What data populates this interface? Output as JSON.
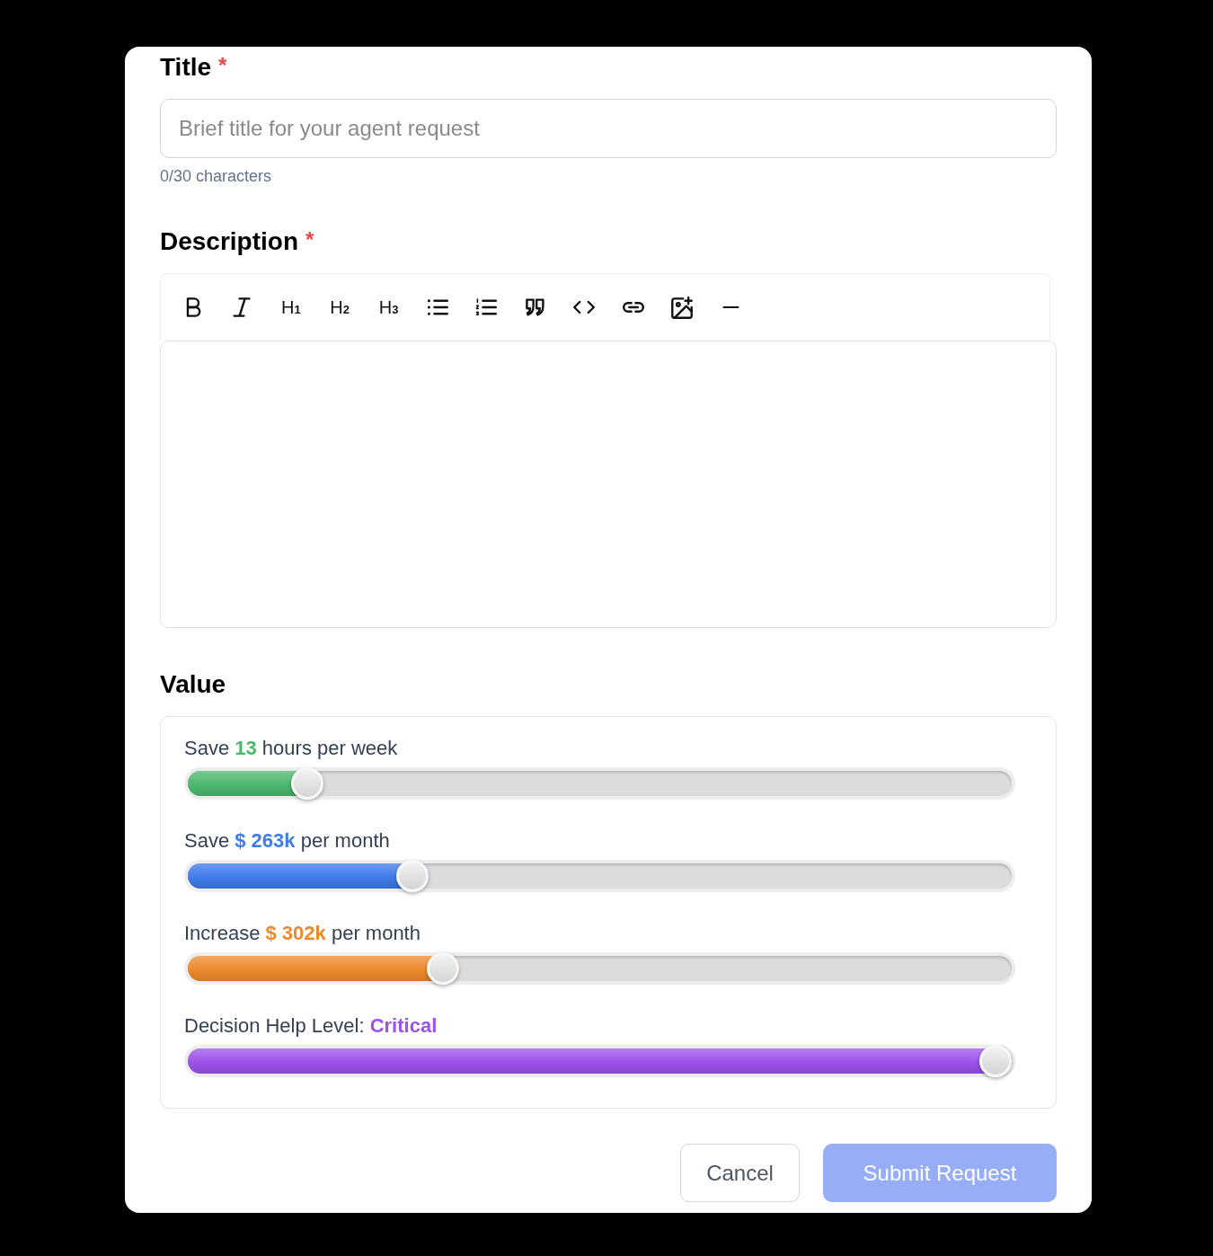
{
  "title_field": {
    "label": "Title",
    "required_mark": "*",
    "placeholder": "Brief title for your agent request",
    "counter": "0/30 characters"
  },
  "description_field": {
    "label": "Description",
    "required_mark": "*",
    "toolbar": [
      {
        "kind": "bold"
      },
      {
        "kind": "italic"
      },
      {
        "kind": "heading",
        "label": "H$_{1}$"
      },
      {
        "kind": "heading",
        "label": "H$_{2}$"
      },
      {
        "kind": "heading",
        "label": "H$_{3}$"
      },
      {
        "kind": "bullet-list"
      },
      {
        "kind": "ordered-list"
      },
      {
        "kind": "quote"
      },
      {
        "kind": "code"
      },
      {
        "kind": "link"
      },
      {
        "kind": "image"
      },
      {
        "kind": "rule"
      }
    ]
  },
  "value_section": {
    "label": "Value",
    "sliders": [
      {
        "prefix": "Save",
        "value": "13",
        "suffix": "hours per week",
        "color": "#4cb86e",
        "level": 0.13
      },
      {
        "prefix": "Save",
        "value": "$ 263k",
        "suffix": "per month",
        "color": "#3f7be9",
        "level": 0.263
      },
      {
        "prefix": "Increase",
        "value": "$ 302k",
        "suffix": "per month",
        "color": "#ec8a2c",
        "level": 0.302
      },
      {
        "prefix": "Decision Help Level:",
        "value": "Critical",
        "color": "#9d52ea",
        "level": 1
      }
    ]
  },
  "buttons": [
    {
      "label": "Cancel",
      "kind": "cancel",
      "disabled": false
    },
    {
      "label": "Submit Request",
      "kind": "submit",
      "disabled": true
    }
  ]
}
